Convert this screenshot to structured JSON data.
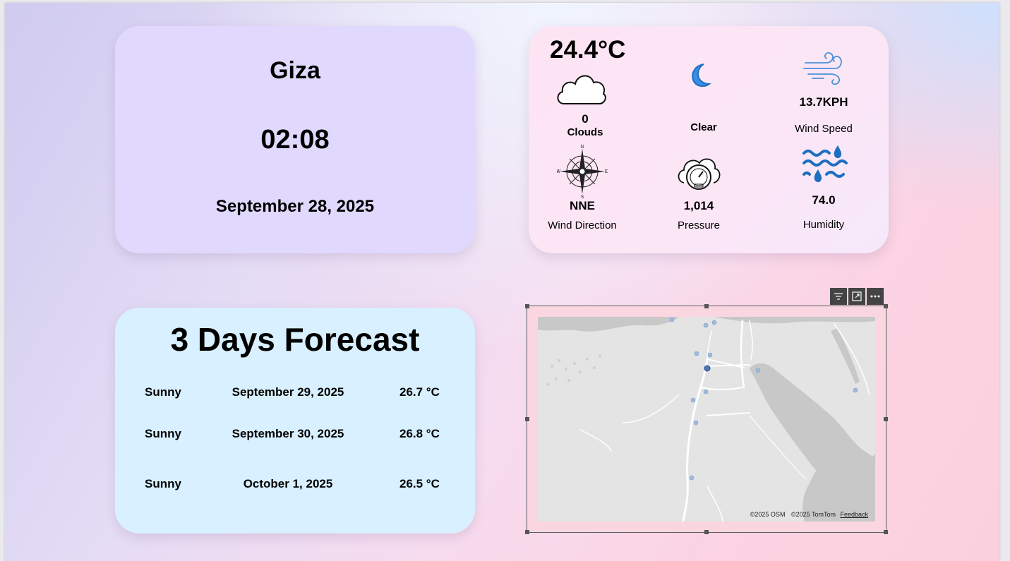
{
  "location": {
    "city": "Giza",
    "time": "02:08",
    "date": "September 28, 2025"
  },
  "current": {
    "temperature": "24.4°C",
    "clouds": {
      "value": "0",
      "label": "Clouds",
      "icon": "cloud-icon"
    },
    "condition": {
      "label": "Clear",
      "icon": "moon-icon"
    },
    "wind_speed": {
      "value": "13.7KPH",
      "label": "Wind Speed",
      "icon": "wind-icon"
    },
    "wind_direction": {
      "value": "NNE",
      "label": "Wind Direction",
      "icon": "compass-icon"
    },
    "pressure": {
      "value": "1,014",
      "label": "Pressure",
      "icon": "pressure-gauge-icon"
    },
    "humidity": {
      "value": "74.0",
      "label": "Humidity",
      "icon": "humidity-icon"
    },
    "compass_letters": {
      "n": "N",
      "s": "S",
      "e": "E",
      "w": "W"
    }
  },
  "forecast": {
    "title": "3 Days Forecast",
    "days": [
      {
        "condition": "Sunny",
        "date": "September 29, 2025",
        "temp": "26.7 °C"
      },
      {
        "condition": "Sunny",
        "date": "September 30, 2025",
        "temp": "26.8 °C"
      },
      {
        "condition": "Sunny",
        "date": "October 1, 2025",
        "temp": "26.5 °C"
      }
    ]
  },
  "map": {
    "attribution_osm": "©2025 OSM",
    "attribution_tomtom": "©2025 TomTom",
    "feedback": "Feedback"
  },
  "visual_toolbar": {
    "buttons": [
      {
        "icon": "filter-icon"
      },
      {
        "icon": "focus-mode-icon"
      },
      {
        "icon": "more-options-icon"
      }
    ]
  },
  "colors": {
    "location_card": "#e0d9fd",
    "current_card": "#fde4f3",
    "forecast_card": "#d8f0ff",
    "icon_blue": "#1f6fbf",
    "map_land": "#e4e4e4",
    "map_water": "#c8c8c8"
  }
}
